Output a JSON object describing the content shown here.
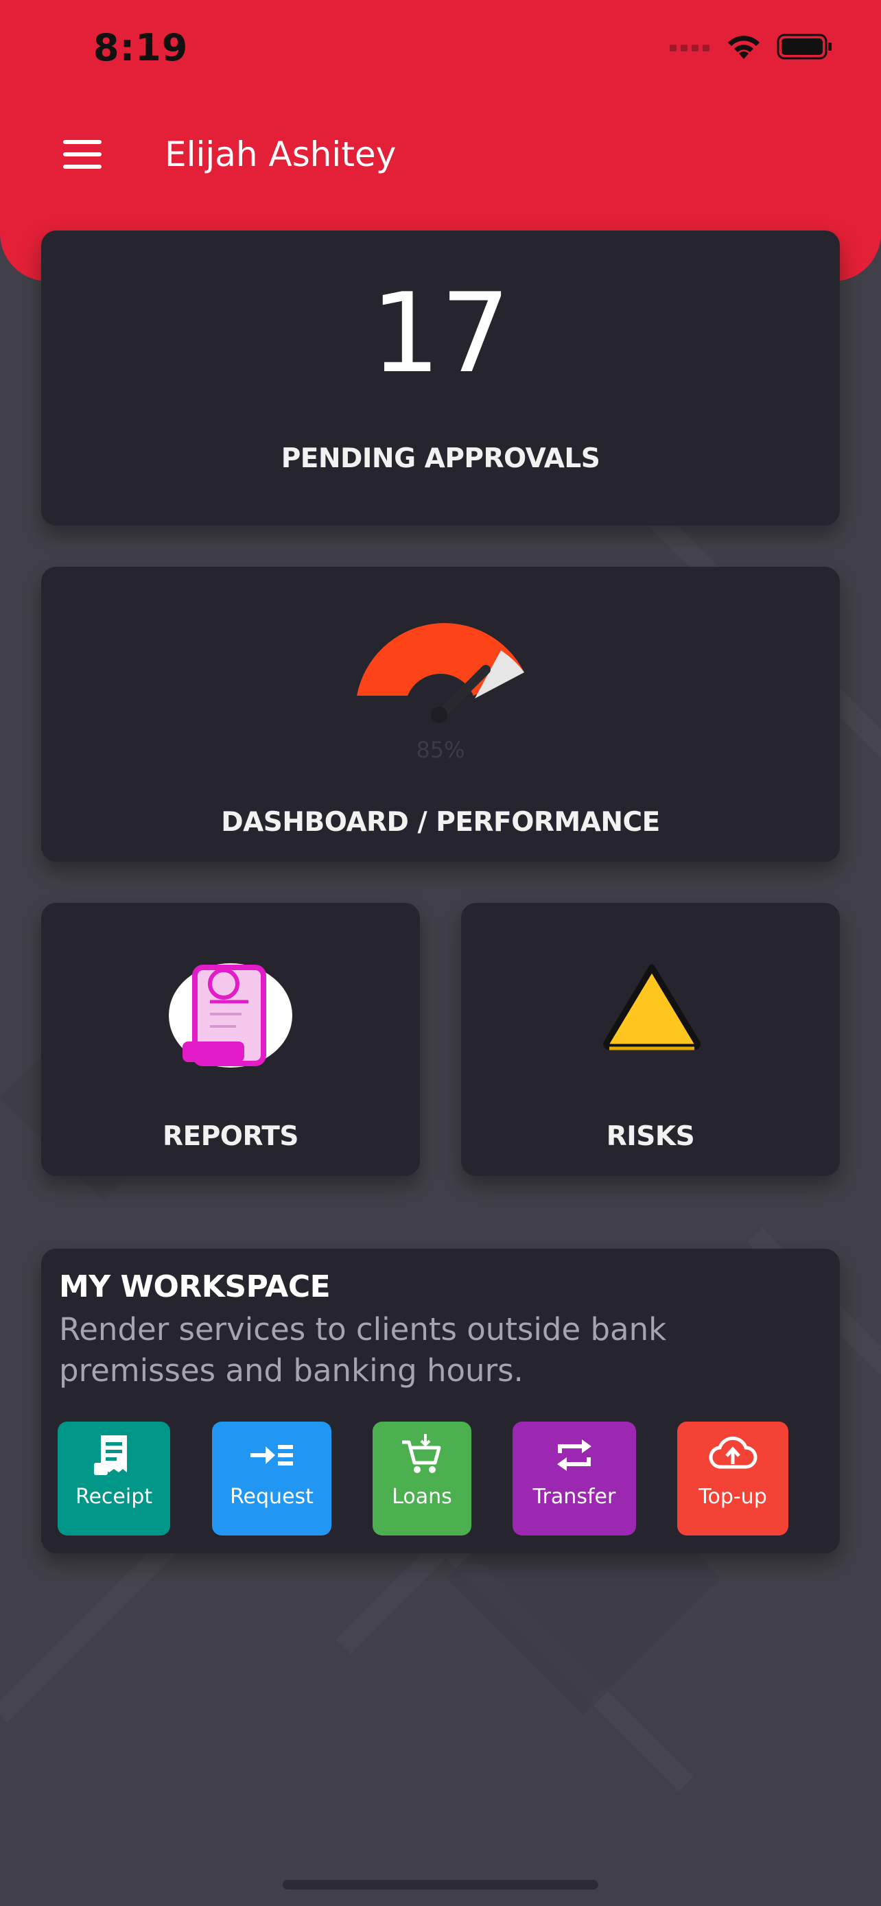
{
  "status_bar": {
    "time": "8:19"
  },
  "header": {
    "title": "Elijah Ashitey"
  },
  "pending": {
    "count": "17",
    "label": "PENDING APPROVALS"
  },
  "performance": {
    "percent_text": "85%",
    "value_percent": 85,
    "label": "DASHBOARD / PERFORMANCE"
  },
  "reports": {
    "label": "REPORTS"
  },
  "risks": {
    "label": "RISKS"
  },
  "workspace": {
    "title": "MY WORKSPACE",
    "description": "Render services to clients outside bank premisses and banking hours.",
    "actions": [
      {
        "label": "Receipt",
        "icon": "receipt-icon",
        "color": "#009688"
      },
      {
        "label": "Request",
        "icon": "request-icon",
        "color": "#2196f3"
      },
      {
        "label": "Loans",
        "icon": "cart-icon",
        "color": "#4caf50"
      },
      {
        "label": "Transfer",
        "icon": "transfer-icon",
        "color": "#9c27b0"
      },
      {
        "label": "Top-up",
        "icon": "cloud-upload-icon",
        "color": "#f44336"
      }
    ]
  },
  "colors": {
    "header": "#e32037",
    "card": "#26252e",
    "background": "#414048",
    "gauge": "#fc4418"
  }
}
